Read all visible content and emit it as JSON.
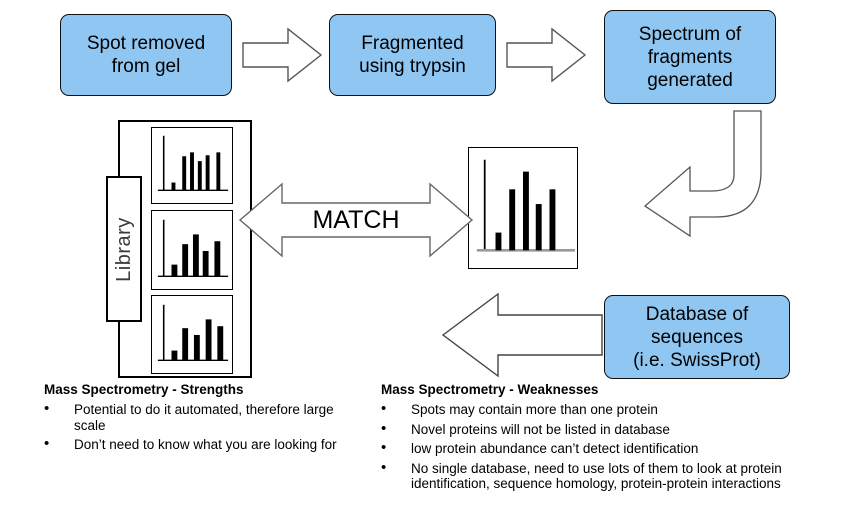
{
  "flow": {
    "steps": [
      {
        "id": "spot-removed",
        "label": "Spot removed\nfrom gel"
      },
      {
        "id": "fragmented",
        "label": "Fragmented\nusing trypsin"
      },
      {
        "id": "spectrum-generated",
        "label": "Spectrum of\nfragments\ngenerated"
      },
      {
        "id": "database",
        "label": "Database of\nsequences\n(i.e. SwissProt)"
      }
    ],
    "arrows": [
      {
        "id": "arrow-step1-to-step2",
        "name": "right-arrow-icon",
        "direction": "right"
      },
      {
        "id": "arrow-step2-to-step3",
        "name": "right-arrow-icon",
        "direction": "right"
      },
      {
        "id": "arrow-spectrum-curved",
        "name": "curved-down-left-arrow-icon",
        "direction": "curved-left"
      },
      {
        "id": "arrow-database-to-library",
        "name": "left-arrow-icon",
        "direction": "left"
      },
      {
        "id": "arrow-match",
        "name": "double-headed-arrow-icon",
        "direction": "both"
      }
    ]
  },
  "library": {
    "label": "Library",
    "spectra": [
      {
        "id": "library-spectrum-1",
        "bars": [
          10,
          45,
          52,
          38,
          48,
          52
        ]
      },
      {
        "id": "library-spectrum-2",
        "bars": [
          18,
          52,
          72,
          42,
          58
        ]
      },
      {
        "id": "library-spectrum-3",
        "bars": [
          15,
          52,
          40,
          72,
          56
        ]
      }
    ]
  },
  "sample": {
    "id": "sample-spectrum",
    "bars": [
      16,
      55,
      76,
      44,
      58
    ]
  },
  "match": {
    "label": "MATCH"
  },
  "strengths": {
    "title": "Mass Spectrometry - Strengths",
    "items": [
      "Potential to do it automated, therefore large scale",
      "Don’t need to know what you are looking for"
    ]
  },
  "weaknesses": {
    "title": "Mass Spectrometry - Weaknesses",
    "items": [
      "Spots may contain more than one protein",
      "Novel proteins will not be listed in database",
      "low protein abundance can’t detect identification",
      "No single database, need to use lots of them to look at protein identification, sequence homology, protein-protein interactions"
    ]
  },
  "bullet_glyph": "•",
  "colors": {
    "box_fill": "#8FC7F2",
    "box_border": "#111111",
    "arrow_fill": "#FFFFFF",
    "arrow_stroke": "#555555",
    "bar": "#000000",
    "baseline": "#9A9A9A",
    "text": "#000000",
    "library_label": "#3A3A3A"
  }
}
